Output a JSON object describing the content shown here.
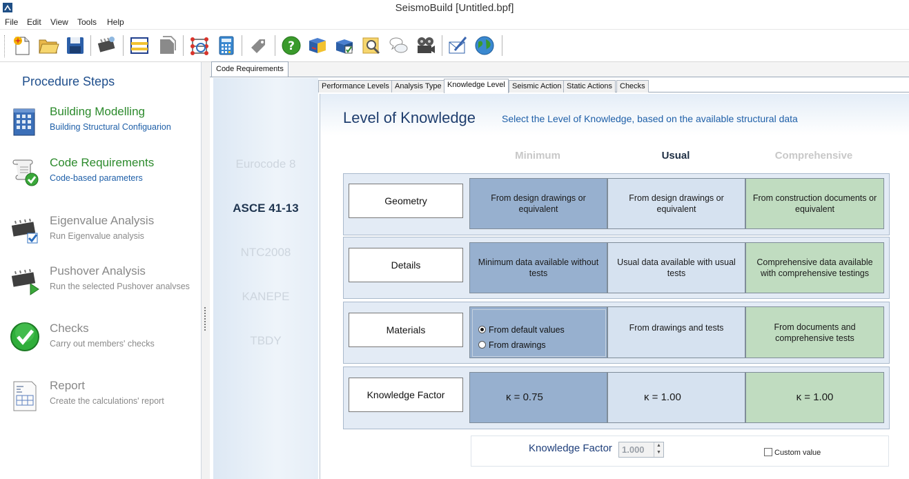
{
  "window": {
    "title": "SeismoBuild   [Untitled.bpf]"
  },
  "menu": [
    "File",
    "Edit",
    "View",
    "Tools",
    "Help"
  ],
  "toolbar": {
    "icons": [
      "new-file-icon",
      "open-folder-icon",
      "save-disk-icon",
      "run-chip-icon",
      "frame-structure-icon",
      "copy-disabled-icon",
      "structure-model-icon",
      "calculator-icon",
      "tag-disabled-icon",
      "help-icon",
      "book-icon",
      "book-check-icon",
      "search-zoom-icon",
      "chat-bubbles-icon",
      "film-reel-icon",
      "pen-letter-icon",
      "globe-icon"
    ]
  },
  "procedure": {
    "title": "Procedure Steps",
    "steps": [
      {
        "title": "Building Modelling",
        "subtitle": "Building Structural Configuarion",
        "icon": "building-icon",
        "state": "active"
      },
      {
        "title": "Code Requirements",
        "subtitle": "Code-based parameters",
        "icon": "scroll-check-icon",
        "state": "active"
      },
      {
        "title": "Eigenvalue Analysis",
        "subtitle": "Run Eigenvalue analysis",
        "icon": "chip-check-icon",
        "state": "disabled"
      },
      {
        "title": "Pushover Analysis",
        "subtitle": "Run the selected Pushover analvses",
        "icon": "chip-play-icon",
        "state": "disabled"
      },
      {
        "title": "Checks",
        "subtitle": "Carry out members' checks",
        "icon": "check-circle-icon",
        "state": "disabled"
      },
      {
        "title": "Report",
        "subtitle": "Create the calculations' report",
        "icon": "report-document-icon",
        "state": "disabled"
      }
    ]
  },
  "outer_tab": {
    "label": "Code Requirements"
  },
  "codes": [
    "Eurocode 8",
    "ASCE 41-13",
    "NTC2008",
    "KANEPE",
    "TBDY"
  ],
  "selected_code": "ASCE 41-13",
  "inner_tabs": [
    "Performance Levels",
    "Analysis Type",
    "Knowledge Level",
    "Seismic Action",
    "Static Actions",
    "Checks"
  ],
  "selected_inner_tab": "Knowledge Level",
  "knowledge": {
    "title": "Level of Knowledge",
    "description": "Select the Level of Knowledge, based on the available structural data",
    "columns": [
      "Minimum",
      "Usual",
      "Comprehensive"
    ],
    "active_column": "Usual",
    "rows": [
      {
        "label": "Geometry",
        "cells": [
          "From design drawings or equivalent",
          "From design drawings or equivalent",
          "From construction documents or equivalent"
        ]
      },
      {
        "label": "Details",
        "cells": [
          "Minimum data available without tests",
          "Usual data available with usual tests",
          "Comprehensive data available with comprehensive testings"
        ]
      },
      {
        "label": "Materials",
        "options": [
          "From default values",
          "From drawings"
        ],
        "selected_option": "From default values",
        "cells": [
          "",
          "From drawings and tests",
          "From documents and comprehensive tests"
        ]
      },
      {
        "label": "Knowledge Factor",
        "cells": [
          "κ = 0.75",
          "κ = 1.00",
          "κ = 1.00"
        ]
      }
    ]
  },
  "knowledge_factor": {
    "label": "Knowledge Factor",
    "value": "1.000",
    "custom_label": "Custom value",
    "custom_checked": false
  },
  "colors": {
    "minimum": "#97b0cf",
    "usual": "#d6e2f0",
    "comprehensive": "#c0dcc0",
    "accent": "#1e5fa8",
    "active_step": "#2c8a2c"
  }
}
